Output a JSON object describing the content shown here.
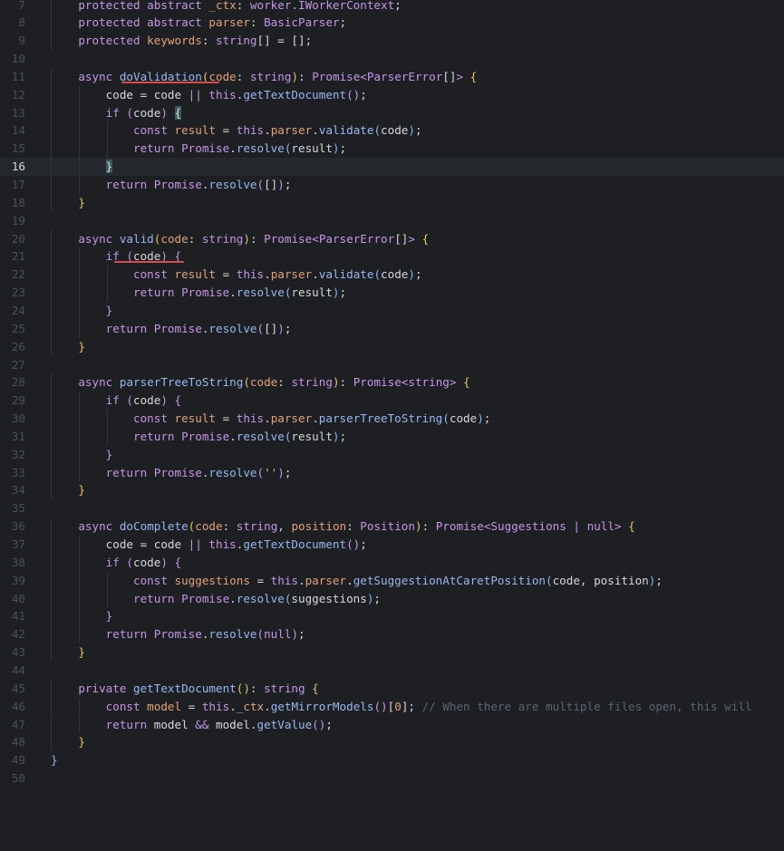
{
  "editor": {
    "lines": [
      {
        "n": "7",
        "ind": 1,
        "t": [
          [
            "kw",
            "protected abstract "
          ],
          [
            "prop",
            "_ctx"
          ],
          [
            "plain",
            ": "
          ],
          [
            "type",
            "worker.IWorkerContext"
          ],
          [
            "plain",
            ";"
          ]
        ]
      },
      {
        "n": "8",
        "ind": 1,
        "t": [
          [
            "kw",
            "protected abstract "
          ],
          [
            "prop",
            "parser"
          ],
          [
            "plain",
            ": "
          ],
          [
            "type",
            "BasicParser"
          ],
          [
            "plain",
            ";"
          ]
        ]
      },
      {
        "n": "9",
        "ind": 1,
        "t": [
          [
            "kw",
            "protected "
          ],
          [
            "prop",
            "keywords"
          ],
          [
            "plain",
            ": "
          ],
          [
            "type",
            "string"
          ],
          [
            "plain",
            "[] = [];"
          ]
        ]
      },
      {
        "n": "10",
        "ind": 0,
        "t": []
      },
      {
        "n": "11",
        "ind": 1,
        "t": [
          [
            "kw",
            "async "
          ],
          [
            "fn",
            "doValidation"
          ],
          [
            "pb",
            "("
          ],
          [
            "prop",
            "code"
          ],
          [
            "plain",
            ": "
          ],
          [
            "type",
            "string"
          ],
          [
            "pb",
            ")"
          ],
          [
            "plain",
            ": "
          ],
          [
            "type",
            "Promise"
          ],
          [
            "op",
            "<"
          ],
          [
            "type",
            "ParserError"
          ],
          [
            "plain",
            "[]"
          ],
          [
            "op",
            "> "
          ],
          [
            "pb",
            "{"
          ]
        ]
      },
      {
        "n": "12",
        "ind": 2,
        "t": [
          [
            "plain",
            "code = code "
          ],
          [
            "op",
            "|| "
          ],
          [
            "kw",
            "this"
          ],
          [
            "plain",
            "."
          ],
          [
            "fn",
            "getTextDocument"
          ],
          [
            "pp",
            "()"
          ],
          [
            "plain",
            ";"
          ]
        ]
      },
      {
        "n": "13",
        "ind": 2,
        "t": [
          [
            "kw",
            "if "
          ],
          [
            "pp",
            "("
          ],
          [
            "plain",
            "code"
          ],
          [
            "pp",
            ") "
          ],
          [
            "bm",
            "{"
          ]
        ]
      },
      {
        "n": "14",
        "ind": 3,
        "t": [
          [
            "kw",
            "const "
          ],
          [
            "prop",
            "result"
          ],
          [
            "plain",
            " = "
          ],
          [
            "kw",
            "this"
          ],
          [
            "plain",
            "."
          ],
          [
            "prop",
            "parser"
          ],
          [
            "plain",
            "."
          ],
          [
            "fn",
            "validate"
          ],
          [
            "pbl",
            "("
          ],
          [
            "plain",
            "code"
          ],
          [
            "pbl",
            ")"
          ],
          [
            "plain",
            ";"
          ]
        ]
      },
      {
        "n": "15",
        "ind": 3,
        "t": [
          [
            "kw",
            "return "
          ],
          [
            "type",
            "Promise"
          ],
          [
            "plain",
            "."
          ],
          [
            "fn",
            "resolve"
          ],
          [
            "pbl",
            "("
          ],
          [
            "plain",
            "result"
          ],
          [
            "pbl",
            ")"
          ],
          [
            "plain",
            ";"
          ]
        ]
      },
      {
        "n": "16",
        "ind": 2,
        "current": true,
        "t": [
          [
            "bm",
            "}"
          ]
        ]
      },
      {
        "n": "17",
        "ind": 2,
        "t": [
          [
            "kw",
            "return "
          ],
          [
            "type",
            "Promise"
          ],
          [
            "plain",
            "."
          ],
          [
            "fn",
            "resolve"
          ],
          [
            "pp",
            "("
          ],
          [
            "plain",
            "[]"
          ],
          [
            "pp",
            ")"
          ],
          [
            "plain",
            ";"
          ]
        ]
      },
      {
        "n": "18",
        "ind": 1,
        "t": [
          [
            "pb",
            "}"
          ]
        ]
      },
      {
        "n": "19",
        "ind": 0,
        "t": []
      },
      {
        "n": "20",
        "ind": 1,
        "t": [
          [
            "kw",
            "async "
          ],
          [
            "fn",
            "valid"
          ],
          [
            "pb",
            "("
          ],
          [
            "prop",
            "code"
          ],
          [
            "plain",
            ": "
          ],
          [
            "type",
            "string"
          ],
          [
            "pb",
            ")"
          ],
          [
            "plain",
            ": "
          ],
          [
            "type",
            "Promise"
          ],
          [
            "op",
            "<"
          ],
          [
            "type",
            "ParserError"
          ],
          [
            "plain",
            "[]"
          ],
          [
            "op",
            "> "
          ],
          [
            "pb",
            "{"
          ]
        ]
      },
      {
        "n": "21",
        "ind": 2,
        "t": [
          [
            "kw",
            "if "
          ],
          [
            "pp",
            "("
          ],
          [
            "plain",
            "code"
          ],
          [
            "pp",
            ") {"
          ]
        ]
      },
      {
        "n": "22",
        "ind": 3,
        "t": [
          [
            "kw",
            "const "
          ],
          [
            "prop",
            "result"
          ],
          [
            "plain",
            " = "
          ],
          [
            "kw",
            "this"
          ],
          [
            "plain",
            "."
          ],
          [
            "prop",
            "parser"
          ],
          [
            "plain",
            "."
          ],
          [
            "fn",
            "validate"
          ],
          [
            "pbl",
            "("
          ],
          [
            "plain",
            "code"
          ],
          [
            "pbl",
            ")"
          ],
          [
            "plain",
            ";"
          ]
        ]
      },
      {
        "n": "23",
        "ind": 3,
        "t": [
          [
            "kw",
            "return "
          ],
          [
            "type",
            "Promise"
          ],
          [
            "plain",
            "."
          ],
          [
            "fn",
            "resolve"
          ],
          [
            "pbl",
            "("
          ],
          [
            "plain",
            "result"
          ],
          [
            "pbl",
            ")"
          ],
          [
            "plain",
            ";"
          ]
        ]
      },
      {
        "n": "24",
        "ind": 2,
        "t": [
          [
            "pp",
            "}"
          ]
        ]
      },
      {
        "n": "25",
        "ind": 2,
        "t": [
          [
            "kw",
            "return "
          ],
          [
            "type",
            "Promise"
          ],
          [
            "plain",
            "."
          ],
          [
            "fn",
            "resolve"
          ],
          [
            "pp",
            "("
          ],
          [
            "plain",
            "[]"
          ],
          [
            "pp",
            ")"
          ],
          [
            "plain",
            ";"
          ]
        ]
      },
      {
        "n": "26",
        "ind": 1,
        "t": [
          [
            "pb",
            "}"
          ]
        ]
      },
      {
        "n": "27",
        "ind": 0,
        "t": []
      },
      {
        "n": "28",
        "ind": 1,
        "t": [
          [
            "kw",
            "async "
          ],
          [
            "fn",
            "parserTreeToString"
          ],
          [
            "pb",
            "("
          ],
          [
            "prop",
            "code"
          ],
          [
            "plain",
            ": "
          ],
          [
            "type",
            "string"
          ],
          [
            "pb",
            ")"
          ],
          [
            "plain",
            ": "
          ],
          [
            "type",
            "Promise"
          ],
          [
            "op",
            "<"
          ],
          [
            "type",
            "string"
          ],
          [
            "op",
            "> "
          ],
          [
            "pb",
            "{"
          ]
        ]
      },
      {
        "n": "29",
        "ind": 2,
        "t": [
          [
            "kw",
            "if "
          ],
          [
            "pp",
            "("
          ],
          [
            "plain",
            "code"
          ],
          [
            "pp",
            ") {"
          ]
        ]
      },
      {
        "n": "30",
        "ind": 3,
        "t": [
          [
            "kw",
            "const "
          ],
          [
            "prop",
            "result"
          ],
          [
            "plain",
            " = "
          ],
          [
            "kw",
            "this"
          ],
          [
            "plain",
            "."
          ],
          [
            "prop",
            "parser"
          ],
          [
            "plain",
            "."
          ],
          [
            "fn",
            "parserTreeToString"
          ],
          [
            "pbl",
            "("
          ],
          [
            "plain",
            "code"
          ],
          [
            "pbl",
            ")"
          ],
          [
            "plain",
            ";"
          ]
        ]
      },
      {
        "n": "31",
        "ind": 3,
        "t": [
          [
            "kw",
            "return "
          ],
          [
            "type",
            "Promise"
          ],
          [
            "plain",
            "."
          ],
          [
            "fn",
            "resolve"
          ],
          [
            "pbl",
            "("
          ],
          [
            "plain",
            "result"
          ],
          [
            "pbl",
            ")"
          ],
          [
            "plain",
            ";"
          ]
        ]
      },
      {
        "n": "32",
        "ind": 2,
        "t": [
          [
            "pp",
            "}"
          ]
        ]
      },
      {
        "n": "33",
        "ind": 2,
        "t": [
          [
            "kw",
            "return "
          ],
          [
            "type",
            "Promise"
          ],
          [
            "plain",
            "."
          ],
          [
            "fn",
            "resolve"
          ],
          [
            "pp",
            "("
          ],
          [
            "str",
            "''"
          ],
          [
            "pp",
            ")"
          ],
          [
            "plain",
            ";"
          ]
        ]
      },
      {
        "n": "34",
        "ind": 1,
        "t": [
          [
            "pb",
            "}"
          ]
        ]
      },
      {
        "n": "35",
        "ind": 0,
        "t": []
      },
      {
        "n": "36",
        "ind": 1,
        "t": [
          [
            "kw",
            "async "
          ],
          [
            "fn",
            "doComplete"
          ],
          [
            "pb",
            "("
          ],
          [
            "prop",
            "code"
          ],
          [
            "plain",
            ": "
          ],
          [
            "type",
            "string"
          ],
          [
            "plain",
            ", "
          ],
          [
            "prop",
            "position"
          ],
          [
            "plain",
            ": "
          ],
          [
            "type",
            "Position"
          ],
          [
            "pb",
            ")"
          ],
          [
            "plain",
            ": "
          ],
          [
            "type",
            "Promise"
          ],
          [
            "op",
            "<"
          ],
          [
            "type",
            "Suggestions "
          ],
          [
            "op",
            "| "
          ],
          [
            "type",
            "null"
          ],
          [
            "op",
            "> "
          ],
          [
            "pb",
            "{"
          ]
        ]
      },
      {
        "n": "37",
        "ind": 2,
        "t": [
          [
            "plain",
            "code = code "
          ],
          [
            "op",
            "|| "
          ],
          [
            "kw",
            "this"
          ],
          [
            "plain",
            "."
          ],
          [
            "fn",
            "getTextDocument"
          ],
          [
            "pp",
            "()"
          ],
          [
            "plain",
            ";"
          ]
        ]
      },
      {
        "n": "38",
        "ind": 2,
        "t": [
          [
            "kw",
            "if "
          ],
          [
            "pp",
            "("
          ],
          [
            "plain",
            "code"
          ],
          [
            "pp",
            ") {"
          ]
        ]
      },
      {
        "n": "39",
        "ind": 3,
        "t": [
          [
            "kw",
            "const "
          ],
          [
            "prop",
            "suggestions"
          ],
          [
            "plain",
            " = "
          ],
          [
            "kw",
            "this"
          ],
          [
            "plain",
            "."
          ],
          [
            "prop",
            "parser"
          ],
          [
            "plain",
            "."
          ],
          [
            "fn",
            "getSuggestionAtCaretPosition"
          ],
          [
            "pbl",
            "("
          ],
          [
            "plain",
            "code, position"
          ],
          [
            "pbl",
            ")"
          ],
          [
            "plain",
            ";"
          ]
        ]
      },
      {
        "n": "40",
        "ind": 3,
        "t": [
          [
            "kw",
            "return "
          ],
          [
            "type",
            "Promise"
          ],
          [
            "plain",
            "."
          ],
          [
            "fn",
            "resolve"
          ],
          [
            "pbl",
            "("
          ],
          [
            "plain",
            "suggestions"
          ],
          [
            "pbl",
            ")"
          ],
          [
            "plain",
            ";"
          ]
        ]
      },
      {
        "n": "41",
        "ind": 2,
        "t": [
          [
            "pp",
            "}"
          ]
        ]
      },
      {
        "n": "42",
        "ind": 2,
        "t": [
          [
            "kw",
            "return "
          ],
          [
            "type",
            "Promise"
          ],
          [
            "plain",
            "."
          ],
          [
            "fn",
            "resolve"
          ],
          [
            "pp",
            "("
          ],
          [
            "kw",
            "null"
          ],
          [
            "pp",
            ")"
          ],
          [
            "plain",
            ";"
          ]
        ]
      },
      {
        "n": "43",
        "ind": 1,
        "t": [
          [
            "pb",
            "}"
          ]
        ]
      },
      {
        "n": "44",
        "ind": 0,
        "t": []
      },
      {
        "n": "45",
        "ind": 1,
        "t": [
          [
            "kw",
            "private "
          ],
          [
            "fn",
            "getTextDocument"
          ],
          [
            "pb",
            "()"
          ],
          [
            "plain",
            ": "
          ],
          [
            "type",
            "string "
          ],
          [
            "pb",
            "{"
          ]
        ]
      },
      {
        "n": "46",
        "ind": 2,
        "t": [
          [
            "kw",
            "const "
          ],
          [
            "prop",
            "model"
          ],
          [
            "plain",
            " = "
          ],
          [
            "kw",
            "this"
          ],
          [
            "plain",
            "."
          ],
          [
            "prop",
            "_ctx"
          ],
          [
            "plain",
            "."
          ],
          [
            "fn",
            "getMirrorModels"
          ],
          [
            "pp",
            "()"
          ],
          [
            "plain",
            "["
          ],
          [
            "prop",
            "0"
          ],
          [
            "plain",
            "]; "
          ],
          [
            "cmt",
            "// When there are multiple files open, this will"
          ]
        ]
      },
      {
        "n": "47",
        "ind": 2,
        "t": [
          [
            "kw",
            "return "
          ],
          [
            "plain",
            "model "
          ],
          [
            "op",
            "&& "
          ],
          [
            "plain",
            "model."
          ],
          [
            "fn",
            "getValue"
          ],
          [
            "pp",
            "()"
          ],
          [
            "plain",
            ";"
          ]
        ]
      },
      {
        "n": "48",
        "ind": 1,
        "t": [
          [
            "pb",
            "}"
          ]
        ]
      },
      {
        "n": "49",
        "ind": 0,
        "t": [
          [
            "pbl",
            "}"
          ]
        ]
      },
      {
        "n": "50",
        "ind": 0,
        "t": []
      }
    ]
  }
}
